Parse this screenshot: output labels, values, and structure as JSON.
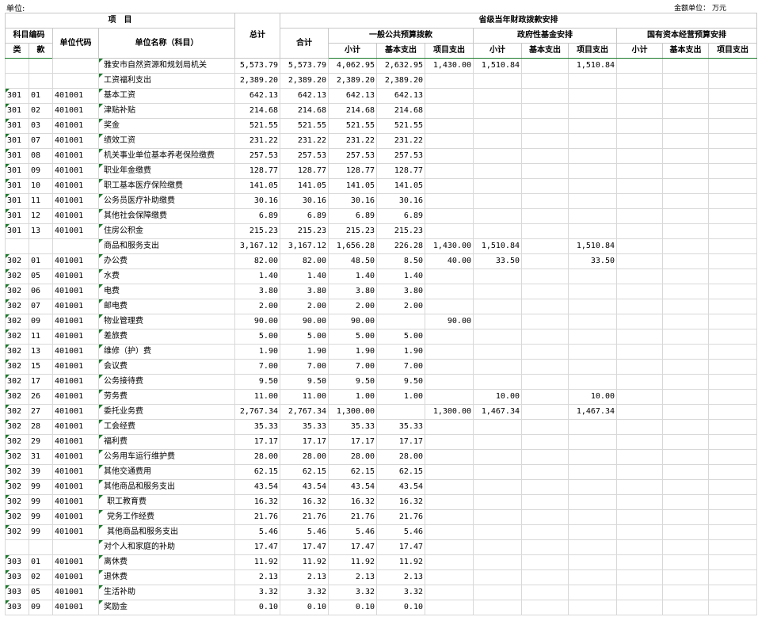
{
  "meta": {
    "unit_left": "单位:",
    "unit_right": "金额单位： 万元"
  },
  "header": {
    "project": "项　目",
    "subject_code": "科目编码",
    "class": "类",
    "item": "款",
    "unit_code": "单位代码",
    "unit_name": "单位名称（科目）",
    "total": "总计",
    "provincial": "省级当年财政拨款安排",
    "sum": "合计",
    "general": "一般公共预算拨款",
    "fund": "政府性基金安排",
    "state_capital": "国有资本经营预算安排",
    "subtotal": "小计",
    "basic": "基本支出",
    "project_exp": "项目支出"
  },
  "rows": [
    {
      "c": "",
      "k": "",
      "u": "",
      "n": "雅安市自然资源和规划局机关",
      "tri": false,
      "v": [
        "5,573.79",
        "5,573.79",
        "4,062.95",
        "2,632.95",
        "1,430.00",
        "1,510.84",
        "",
        "1,510.84",
        "",
        "",
        ""
      ]
    },
    {
      "c": "",
      "k": "",
      "u": "",
      "n": "工资福利支出",
      "tri": false,
      "v": [
        "2,389.20",
        "2,389.20",
        "2,389.20",
        "2,389.20",
        "",
        "",
        "",
        "",
        "",
        "",
        ""
      ]
    },
    {
      "c": "301",
      "k": "01",
      "u": "401001",
      "n": "基本工资",
      "tri": true,
      "v": [
        "642.13",
        "642.13",
        "642.13",
        "642.13",
        "",
        "",
        "",
        "",
        "",
        "",
        ""
      ]
    },
    {
      "c": "301",
      "k": "02",
      "u": "401001",
      "n": "津贴补贴",
      "tri": true,
      "v": [
        "214.68",
        "214.68",
        "214.68",
        "214.68",
        "",
        "",
        "",
        "",
        "",
        "",
        ""
      ]
    },
    {
      "c": "301",
      "k": "03",
      "u": "401001",
      "n": "奖金",
      "tri": true,
      "v": [
        "521.55",
        "521.55",
        "521.55",
        "521.55",
        "",
        "",
        "",
        "",
        "",
        "",
        ""
      ]
    },
    {
      "c": "301",
      "k": "07",
      "u": "401001",
      "n": "绩效工资",
      "tri": true,
      "v": [
        "231.22",
        "231.22",
        "231.22",
        "231.22",
        "",
        "",
        "",
        "",
        "",
        "",
        ""
      ]
    },
    {
      "c": "301",
      "k": "08",
      "u": "401001",
      "n": "机关事业单位基本养老保险缴费",
      "tri": true,
      "v": [
        "257.53",
        "257.53",
        "257.53",
        "257.53",
        "",
        "",
        "",
        "",
        "",
        "",
        ""
      ]
    },
    {
      "c": "301",
      "k": "09",
      "u": "401001",
      "n": "职业年金缴费",
      "tri": true,
      "v": [
        "128.77",
        "128.77",
        "128.77",
        "128.77",
        "",
        "",
        "",
        "",
        "",
        "",
        ""
      ]
    },
    {
      "c": "301",
      "k": "10",
      "u": "401001",
      "n": "职工基本医疗保险缴费",
      "tri": true,
      "v": [
        "141.05",
        "141.05",
        "141.05",
        "141.05",
        "",
        "",
        "",
        "",
        "",
        "",
        ""
      ]
    },
    {
      "c": "301",
      "k": "11",
      "u": "401001",
      "n": "公务员医疗补助缴费",
      "tri": true,
      "v": [
        "30.16",
        "30.16",
        "30.16",
        "30.16",
        "",
        "",
        "",
        "",
        "",
        "",
        ""
      ]
    },
    {
      "c": "301",
      "k": "12",
      "u": "401001",
      "n": "其他社会保障缴费",
      "tri": true,
      "v": [
        "6.89",
        "6.89",
        "6.89",
        "6.89",
        "",
        "",
        "",
        "",
        "",
        "",
        ""
      ]
    },
    {
      "c": "301",
      "k": "13",
      "u": "401001",
      "n": "住房公积金",
      "tri": true,
      "v": [
        "215.23",
        "215.23",
        "215.23",
        "215.23",
        "",
        "",
        "",
        "",
        "",
        "",
        ""
      ]
    },
    {
      "c": "",
      "k": "",
      "u": "",
      "n": "商品和服务支出",
      "tri": false,
      "v": [
        "3,167.12",
        "3,167.12",
        "1,656.28",
        "226.28",
        "1,430.00",
        "1,510.84",
        "",
        "1,510.84",
        "",
        "",
        ""
      ]
    },
    {
      "c": "302",
      "k": "01",
      "u": "401001",
      "n": "办公费",
      "tri": true,
      "v": [
        "82.00",
        "82.00",
        "48.50",
        "8.50",
        "40.00",
        "33.50",
        "",
        "33.50",
        "",
        "",
        ""
      ]
    },
    {
      "c": "302",
      "k": "05",
      "u": "401001",
      "n": "水费",
      "tri": true,
      "v": [
        "1.40",
        "1.40",
        "1.40",
        "1.40",
        "",
        "",
        "",
        "",
        "",
        "",
        ""
      ]
    },
    {
      "c": "302",
      "k": "06",
      "u": "401001",
      "n": "电费",
      "tri": true,
      "v": [
        "3.80",
        "3.80",
        "3.80",
        "3.80",
        "",
        "",
        "",
        "",
        "",
        "",
        ""
      ]
    },
    {
      "c": "302",
      "k": "07",
      "u": "401001",
      "n": "邮电费",
      "tri": true,
      "v": [
        "2.00",
        "2.00",
        "2.00",
        "2.00",
        "",
        "",
        "",
        "",
        "",
        "",
        ""
      ]
    },
    {
      "c": "302",
      "k": "09",
      "u": "401001",
      "n": "物业管理费",
      "tri": true,
      "v": [
        "90.00",
        "90.00",
        "90.00",
        "",
        "90.00",
        "",
        "",
        "",
        "",
        "",
        ""
      ]
    },
    {
      "c": "302",
      "k": "11",
      "u": "401001",
      "n": "差旅费",
      "tri": true,
      "v": [
        "5.00",
        "5.00",
        "5.00",
        "5.00",
        "",
        "",
        "",
        "",
        "",
        "",
        ""
      ]
    },
    {
      "c": "302",
      "k": "13",
      "u": "401001",
      "n": "维修（护）费",
      "tri": true,
      "v": [
        "1.90",
        "1.90",
        "1.90",
        "1.90",
        "",
        "",
        "",
        "",
        "",
        "",
        ""
      ]
    },
    {
      "c": "302",
      "k": "15",
      "u": "401001",
      "n": "会议费",
      "tri": true,
      "v": [
        "7.00",
        "7.00",
        "7.00",
        "7.00",
        "",
        "",
        "",
        "",
        "",
        "",
        ""
      ]
    },
    {
      "c": "302",
      "k": "17",
      "u": "401001",
      "n": "公务接待费",
      "tri": true,
      "v": [
        "9.50",
        "9.50",
        "9.50",
        "9.50",
        "",
        "",
        "",
        "",
        "",
        "",
        ""
      ]
    },
    {
      "c": "302",
      "k": "26",
      "u": "401001",
      "n": "劳务费",
      "tri": true,
      "v": [
        "11.00",
        "11.00",
        "1.00",
        "1.00",
        "",
        "10.00",
        "",
        "10.00",
        "",
        "",
        ""
      ]
    },
    {
      "c": "302",
      "k": "27",
      "u": "401001",
      "n": "委托业务费",
      "tri": true,
      "v": [
        "2,767.34",
        "2,767.34",
        "1,300.00",
        "",
        "1,300.00",
        "1,467.34",
        "",
        "1,467.34",
        "",
        "",
        ""
      ]
    },
    {
      "c": "302",
      "k": "28",
      "u": "401001",
      "n": "工会经费",
      "tri": true,
      "v": [
        "35.33",
        "35.33",
        "35.33",
        "35.33",
        "",
        "",
        "",
        "",
        "",
        "",
        ""
      ]
    },
    {
      "c": "302",
      "k": "29",
      "u": "401001",
      "n": "福利费",
      "tri": true,
      "v": [
        "17.17",
        "17.17",
        "17.17",
        "17.17",
        "",
        "",
        "",
        "",
        "",
        "",
        ""
      ]
    },
    {
      "c": "302",
      "k": "31",
      "u": "401001",
      "n": "公务用车运行维护费",
      "tri": true,
      "v": [
        "28.00",
        "28.00",
        "28.00",
        "28.00",
        "",
        "",
        "",
        "",
        "",
        "",
        ""
      ]
    },
    {
      "c": "302",
      "k": "39",
      "u": "401001",
      "n": "其他交通费用",
      "tri": true,
      "v": [
        "62.15",
        "62.15",
        "62.15",
        "62.15",
        "",
        "",
        "",
        "",
        "",
        "",
        ""
      ]
    },
    {
      "c": "302",
      "k": "99",
      "u": "401001",
      "n": "其他商品和服务支出",
      "tri": true,
      "v": [
        "43.54",
        "43.54",
        "43.54",
        "43.54",
        "",
        "",
        "",
        "",
        "",
        "",
        ""
      ]
    },
    {
      "c": "302",
      "k": "99",
      "u": "401001",
      "n": "职工教育费",
      "tri": true,
      "sub": true,
      "v": [
        "16.32",
        "16.32",
        "16.32",
        "16.32",
        "",
        "",
        "",
        "",
        "",
        "",
        ""
      ]
    },
    {
      "c": "302",
      "k": "99",
      "u": "401001",
      "n": "党务工作经费",
      "tri": true,
      "sub": true,
      "v": [
        "21.76",
        "21.76",
        "21.76",
        "21.76",
        "",
        "",
        "",
        "",
        "",
        "",
        ""
      ]
    },
    {
      "c": "302",
      "k": "99",
      "u": "401001",
      "n": "其他商品和服务支出",
      "tri": true,
      "sub": true,
      "v": [
        "5.46",
        "5.46",
        "5.46",
        "5.46",
        "",
        "",
        "",
        "",
        "",
        "",
        ""
      ]
    },
    {
      "c": "",
      "k": "",
      "u": "",
      "n": "对个人和家庭的补助",
      "tri": false,
      "v": [
        "17.47",
        "17.47",
        "17.47",
        "17.47",
        "",
        "",
        "",
        "",
        "",
        "",
        ""
      ]
    },
    {
      "c": "303",
      "k": "01",
      "u": "401001",
      "n": "离休费",
      "tri": true,
      "v": [
        "11.92",
        "11.92",
        "11.92",
        "11.92",
        "",
        "",
        "",
        "",
        "",
        "",
        ""
      ]
    },
    {
      "c": "303",
      "k": "02",
      "u": "401001",
      "n": "退休费",
      "tri": true,
      "v": [
        "2.13",
        "2.13",
        "2.13",
        "2.13",
        "",
        "",
        "",
        "",
        "",
        "",
        ""
      ]
    },
    {
      "c": "303",
      "k": "05",
      "u": "401001",
      "n": "生活补助",
      "tri": true,
      "v": [
        "3.32",
        "3.32",
        "3.32",
        "3.32",
        "",
        "",
        "",
        "",
        "",
        "",
        ""
      ]
    },
    {
      "c": "303",
      "k": "09",
      "u": "401001",
      "n": "奖励金",
      "tri": true,
      "v": [
        "0.10",
        "0.10",
        "0.10",
        "0.10",
        "",
        "",
        "",
        "",
        "",
        "",
        ""
      ]
    }
  ]
}
